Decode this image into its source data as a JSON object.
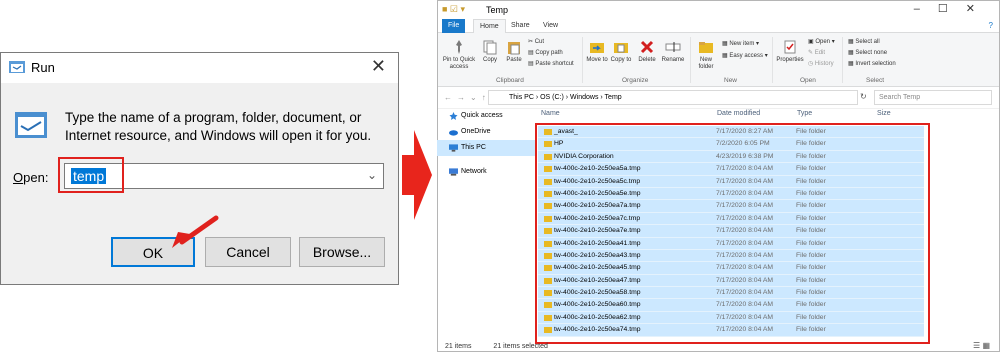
{
  "run_dialog": {
    "title": "Run",
    "close_glyph": "✕",
    "message": "Type the name of a program, folder, document, or Internet resource, and Windows will open it for you.",
    "open_label_underlined": "O",
    "open_label_rest": "pen:",
    "input_value": "temp",
    "dropdown_glyph": "⌄",
    "ok_label": "OK",
    "cancel_label": "Cancel",
    "browse_label": "Browse..."
  },
  "explorer": {
    "title": "Temp",
    "window_controls": "–☐✕",
    "tabs": [
      "File",
      "Home",
      "Share",
      "View"
    ],
    "help_glyph": "?",
    "ribbon": {
      "pin_to_quick_access": "Pin to Quick access",
      "copy": "Copy",
      "paste": "Paste",
      "cut": "Cut",
      "copy_path": "Copy path",
      "paste_shortcut": "Paste shortcut",
      "move_to": "Move to",
      "copy_to": "Copy to",
      "delete": "Delete",
      "rename": "Rename",
      "new_folder": "New folder",
      "new_item": "New item",
      "easy_access": "Easy access",
      "properties": "Properties",
      "open": "Open",
      "edit": "Edit",
      "history": "History",
      "select_all": "Select all",
      "select_none": "Select none",
      "invert_selection": "Invert selection",
      "groups": [
        "Clipboard",
        "Organize",
        "New",
        "Open",
        "Select"
      ]
    },
    "nav_buttons": "←→⌄↑",
    "path": "This PC  ›  OS (C:)  ›  Windows  ›  Temp",
    "refresh_glyph": "↻",
    "search_placeholder": "Search Temp",
    "sidebar": [
      "Quick access",
      "OneDrive",
      "This PC",
      "Network"
    ],
    "columns": {
      "name": "Name",
      "date": "Date modified",
      "type": "Type",
      "size": "Size"
    },
    "files": [
      {
        "name": "_avast_",
        "date": "7/17/2020 8:27 AM",
        "type": "File folder"
      },
      {
        "name": "HP",
        "date": "7/2/2020 6:05 PM",
        "type": "File folder"
      },
      {
        "name": "NVIDIA Corporation",
        "date": "4/23/2019 6:38 PM",
        "type": "File folder"
      },
      {
        "name": "tw-400c-2e10-2c50ea5a.tmp",
        "date": "7/17/2020 8:04 AM",
        "type": "File folder"
      },
      {
        "name": "tw-400c-2e10-2c50ea5c.tmp",
        "date": "7/17/2020 8:04 AM",
        "type": "File folder"
      },
      {
        "name": "tw-400c-2e10-2c50ea5e.tmp",
        "date": "7/17/2020 8:04 AM",
        "type": "File folder"
      },
      {
        "name": "tw-400c-2e10-2c50ea7a.tmp",
        "date": "7/17/2020 8:04 AM",
        "type": "File folder"
      },
      {
        "name": "tw-400c-2e10-2c50ea7c.tmp",
        "date": "7/17/2020 8:04 AM",
        "type": "File folder"
      },
      {
        "name": "tw-400c-2e10-2c50ea7e.tmp",
        "date": "7/17/2020 8:04 AM",
        "type": "File folder"
      },
      {
        "name": "tw-400c-2e10-2c50ea41.tmp",
        "date": "7/17/2020 8:04 AM",
        "type": "File folder"
      },
      {
        "name": "tw-400c-2e10-2c50ea43.tmp",
        "date": "7/17/2020 8:04 AM",
        "type": "File folder"
      },
      {
        "name": "tw-400c-2e10-2c50ea45.tmp",
        "date": "7/17/2020 8:04 AM",
        "type": "File folder"
      },
      {
        "name": "tw-400c-2e10-2c50ea47.tmp",
        "date": "7/17/2020 8:04 AM",
        "type": "File folder"
      },
      {
        "name": "tw-400c-2e10-2c50ea58.tmp",
        "date": "7/17/2020 8:04 AM",
        "type": "File folder"
      },
      {
        "name": "tw-400c-2e10-2c50ea60.tmp",
        "date": "7/17/2020 8:04 AM",
        "type": "File folder"
      },
      {
        "name": "tw-400c-2e10-2c50ea62.tmp",
        "date": "7/17/2020 8:04 AM",
        "type": "File folder"
      },
      {
        "name": "tw-400c-2e10-2c50ea74.tmp",
        "date": "7/17/2020 8:04 AM",
        "type": "File folder"
      }
    ],
    "status_count": "21 items",
    "status_selected": "21 items selected"
  },
  "colors": {
    "highlight_red": "#e0211d",
    "selection_blue": "#cce8ff",
    "accent_blue": "#0078d7",
    "folder_yellow": "#e8b923"
  },
  "icons": [
    "run-icon",
    "run-big-icon",
    "folder-icon",
    "quick-access-star-icon",
    "onedrive-cloud-icon",
    "this-pc-icon",
    "network-icon"
  ]
}
